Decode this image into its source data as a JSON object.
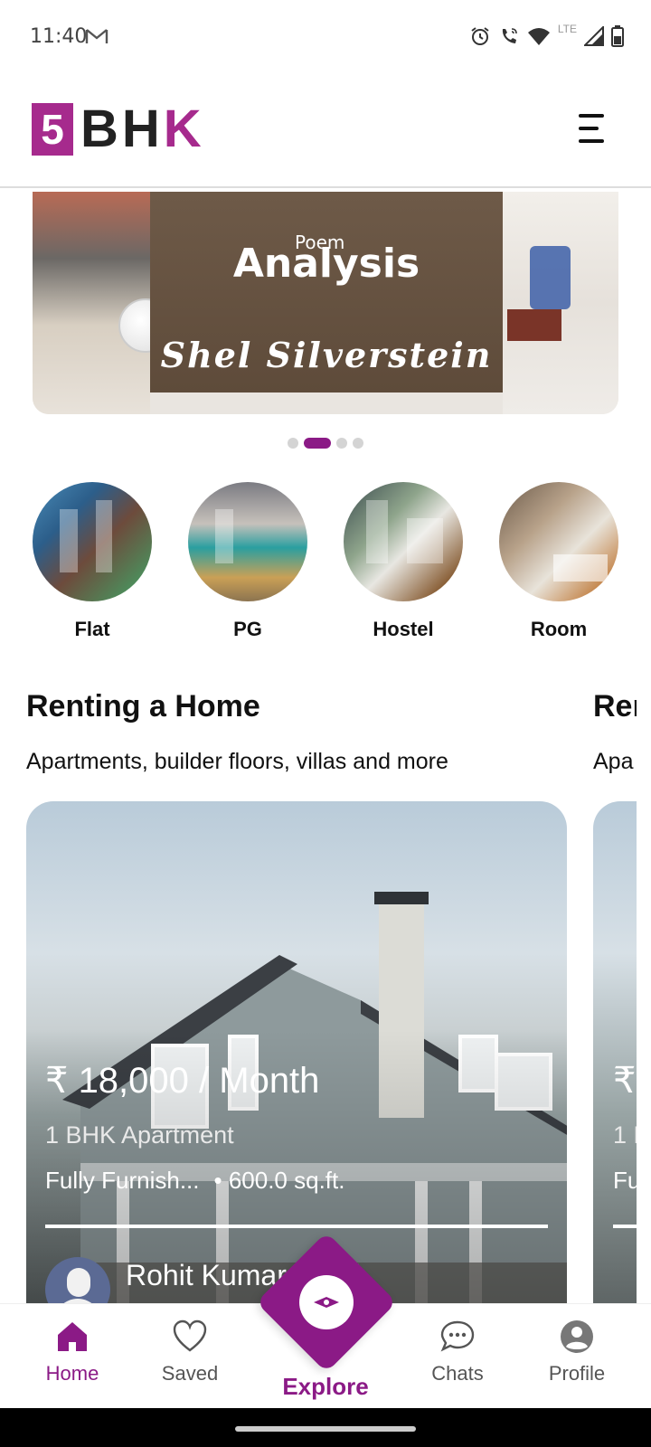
{
  "status_bar": {
    "time": "11:40",
    "network_label": "LTE",
    "icons": [
      "gmail-icon",
      "alarm-icon",
      "wifi-calling-icon",
      "wifi-icon",
      "signal-icon",
      "battery-icon"
    ]
  },
  "header": {
    "logo_number": "5",
    "logo_text": "BH",
    "logo_text_accent": "K",
    "menu_icon": "hamburger-menu-icon"
  },
  "banner": {
    "brand_small": "Poem",
    "brand": "Analysis",
    "author": "Shel Silverstein",
    "dots_total": 4,
    "dots_active_index": 1
  },
  "categories": [
    {
      "label": "Flat"
    },
    {
      "label": "PG"
    },
    {
      "label": "Hostel"
    },
    {
      "label": "Room"
    }
  ],
  "section": {
    "title": "Renting a Home",
    "subtitle": "Apartments, builder floors, villas and more",
    "title_peek": "Rer",
    "subtitle_peek": "Apa"
  },
  "listing": {
    "price": "₹ 18,000 / Month",
    "type": "1 BHK Apartment",
    "furnishing": "Fully Furnish...",
    "area": "• 600.0 sq.ft.",
    "owner_name": "Rohit Kumar Patel"
  },
  "listing_peek": {
    "price": "₹",
    "type": "1 E",
    "meta": "Fu"
  },
  "bottom_nav": {
    "home": "Home",
    "saved": "Saved",
    "explore": "Explore",
    "chats": "Chats",
    "profile": "Profile"
  },
  "colors": {
    "accent": "#8b1a86",
    "logo": "#a62a8d"
  }
}
